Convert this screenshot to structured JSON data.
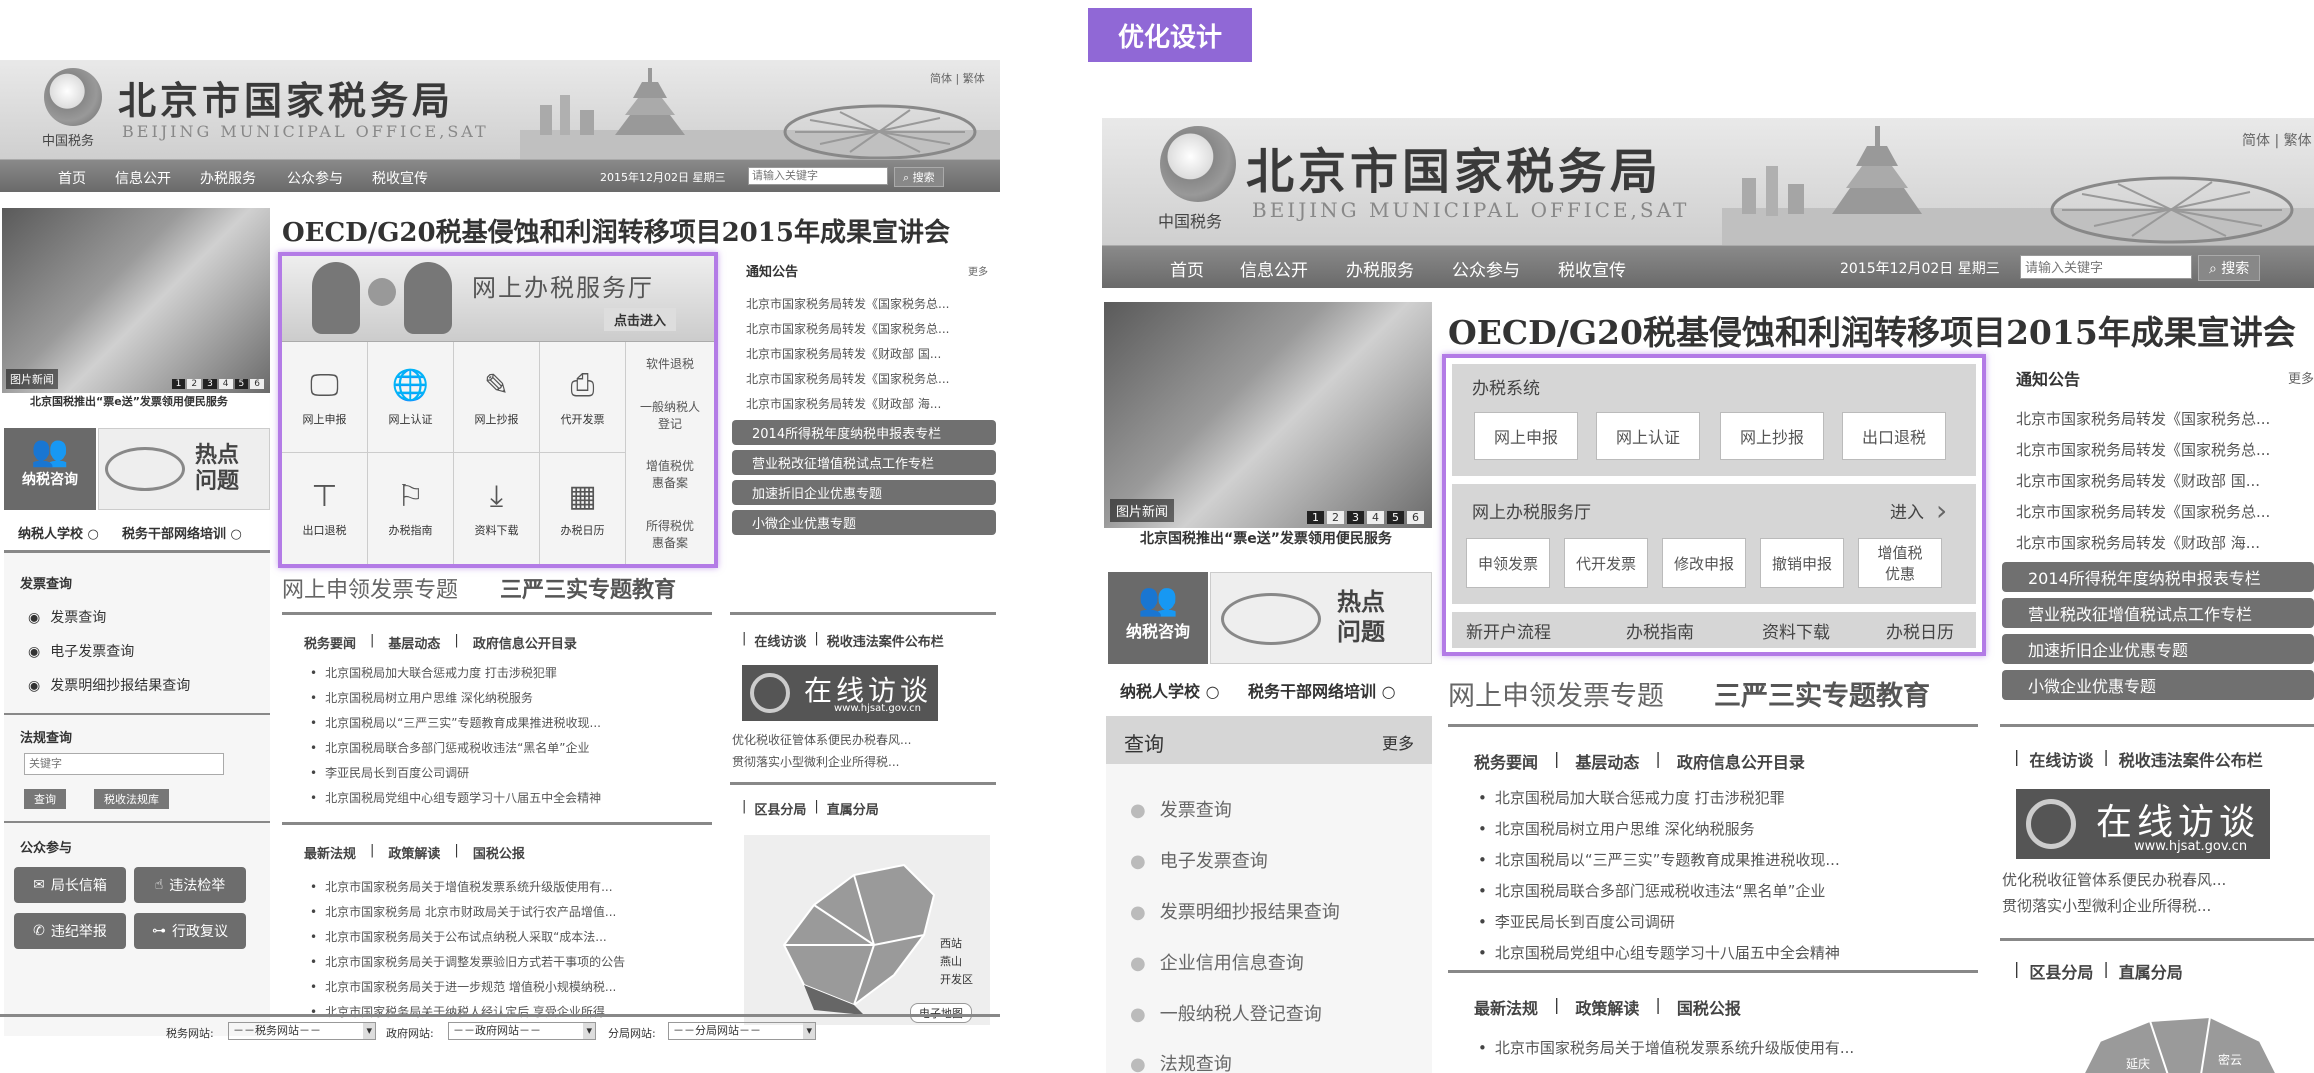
{
  "tag": "优化设计",
  "site": {
    "title_cn": "北京市国家税务局",
    "title_en": "BEIJING MUNICIPAL OFFICE,SAT",
    "emblem_text": "中国税务",
    "lang": "简体 | 繁体"
  },
  "nav": {
    "items": [
      "首页",
      "信息公开",
      "办税服务",
      "公众参与",
      "税收宣传"
    ],
    "date": "2015年12月02日 星期三",
    "search_placeholder": "请输入关键字",
    "search_btn": "搜索"
  },
  "photo": {
    "label": "图片新闻",
    "pages": [
      "1",
      "2",
      "3",
      "4",
      "5",
      "6"
    ],
    "caption": "北京国税推出“票e送”发票领用便民服务"
  },
  "headline": "OECD/G20税基侵蚀和利润转移项目2015年成果宣讲会",
  "left": {
    "hall_title": "网上办税服务厅",
    "hall_enter": "点击进入",
    "icons": [
      {
        "label": "网上申报",
        "icon": "monitor-icon"
      },
      {
        "label": "网上认证",
        "icon": "globe-icon"
      },
      {
        "label": "网上抄报",
        "icon": "pen-icon"
      },
      {
        "label": "代开发票",
        "icon": "printer-icon"
      },
      {
        "label": "出口退税",
        "icon": "table-icon"
      },
      {
        "label": "办税指南",
        "icon": "sign-icon"
      },
      {
        "label": "资料下载",
        "icon": "download-icon"
      },
      {
        "label": "办税日历",
        "icon": "calendar-icon"
      }
    ],
    "side_links": [
      "软件退税",
      "一般纳税人登记",
      "增值税优惠备案",
      "所得税优惠备案"
    ],
    "consult": "纳税咨询",
    "hot": "热点问题",
    "school": "纳税人学校",
    "training": "税务干部网络培训",
    "invoice_title": "发票查询",
    "invoice_items": [
      "发票查询",
      "电子发票查询",
      "发票明细抄报结果查询"
    ],
    "law_title": "法规查询",
    "law_placeholder": "关键字",
    "law_btns": [
      "查询",
      "税收法规库"
    ],
    "public_title": "公众参与",
    "public_btns": [
      "局长信箱",
      "违法检举",
      "违纪举报",
      "行政复议"
    ],
    "topic1": "网上申领发票专题",
    "topic2": "三严三实专题教育",
    "notice_title": "通知公告",
    "more": "更多",
    "notices": [
      "北京市国家税务局转发《国家税务总...",
      "北京市国家税务局转发《国家税务总...",
      "北京市国家税务局转发《财政部 国...",
      "北京市国家税务局转发《国家税务总...",
      "北京市国家税务局转发《财政部 海..."
    ],
    "pills": [
      "2014所得税年度纳税申报表专栏",
      "营业税改征增值税试点工作专栏",
      "加速折旧企业优惠专题",
      "小微企业优惠专题"
    ],
    "tabs1": [
      "税务要闻",
      "基层动态",
      "政府信息公开目录"
    ],
    "news1": [
      "北京国税局加大联合惩戒力度 打击涉税犯罪",
      "北京国税局树立用户思维 深化纳税服务",
      "北京国税局以“三严三实”专题教育成果推进税收现...",
      "北京国税局联合多部门惩戒税收违法“黑名单”企业",
      "李亚民局长到百度公司调研",
      "北京国税局党组中心组专题学习十八届五中全会精神"
    ],
    "tabs2": [
      "最新法规",
      "政策解读",
      "国税公报"
    ],
    "news2": [
      "北京市国家税务局关于增值税发票系统升级版使用有...",
      "北京市国家税务局 北京市财政局关于试行农产品增值...",
      "北京市国家税务局关于公布试点纳税人采取“成本法...",
      "北京市国家税务局关于调整发票验旧方式若干事项的公告",
      "北京市国家税务局关于进一步规范 增值税小规模纳税...",
      "北京市国家税务局关于纳税人经认定后 享受企业所得..."
    ],
    "interview_tabs": [
      "在线访谈",
      "税收违法案件公布栏"
    ],
    "interview_banner": "在线访谈",
    "interview_url": "www.hjsat.gov.cn",
    "interview_links": [
      "优化税收征管体系便民办税春风...",
      "贯彻落实小型微利企业所得税..."
    ],
    "district_tabs": [
      "区县分局",
      "直属分局"
    ],
    "map_labels": [
      "西站",
      "燕山",
      "开发区"
    ],
    "map_btn": "电子地图",
    "footer": [
      {
        "label": "税务网站:",
        "value": "－－税务网站－－"
      },
      {
        "label": "政府网站:",
        "value": "－－政府网站－－"
      },
      {
        "label": "分局网站:",
        "value": "－－分局网站－－"
      }
    ]
  },
  "right": {
    "sys_title": "办税系统",
    "sys_btns": [
      "网上申报",
      "网上认证",
      "网上抄报",
      "出口退税"
    ],
    "hall_title": "网上办税服务厅",
    "hall_enter": "进入",
    "hall_btns": [
      "申领发票",
      "代开发票",
      "修改申报",
      "撤销申报",
      "增值税优惠"
    ],
    "links": [
      "新开户流程",
      "办税指南",
      "资料下载",
      "办税日历"
    ],
    "query_title": "查询",
    "query_more": "更多",
    "query_items": [
      "发票查询",
      "电子发票查询",
      "发票明细抄报结果查询",
      "企业信用信息查询",
      "一般纳税人登记查询",
      "法规查询"
    ],
    "news2_first": "北京市国家税务局关于增值税发票系统升级版使用有...",
    "map_labels": [
      "延庆",
      "密云"
    ]
  }
}
